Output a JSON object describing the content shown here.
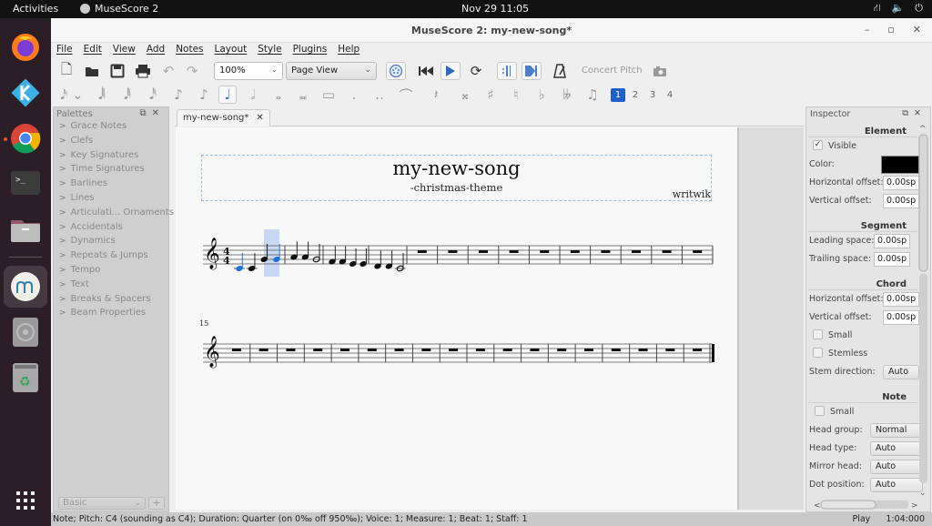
{
  "topbar": {
    "activities": "Activities",
    "app_name": "MuseScore 2",
    "clock": "Nov 29  11:05",
    "tray_icons": [
      "network-icon",
      "volume-icon",
      "power-icon"
    ]
  },
  "dock": {
    "items": [
      {
        "name": "firefox",
        "icon": "firefox-icon",
        "running": false
      },
      {
        "name": "kodi",
        "icon": "kodi-icon",
        "running": false
      },
      {
        "name": "chrome",
        "icon": "chrome-icon",
        "running": true
      },
      {
        "name": "terminal",
        "icon": "terminal-icon",
        "running": false
      },
      {
        "name": "files",
        "icon": "folder-icon",
        "running": false
      },
      {
        "name": "musescore",
        "icon": "musescore-icon",
        "running": true,
        "active": true
      },
      {
        "name": "disc",
        "icon": "disc-icon",
        "running": false
      },
      {
        "name": "trash",
        "icon": "trash-icon",
        "running": false
      }
    ],
    "show_apps": "apps-grid-icon"
  },
  "window": {
    "title": "MuseScore 2: my-new-song*",
    "controls": {
      "minimize": "–",
      "maximize": "▫",
      "close": "✕"
    }
  },
  "menu": [
    "File",
    "Edit",
    "View",
    "Add",
    "Notes",
    "Layout",
    "Style",
    "Plugins",
    "Help"
  ],
  "toolbar": {
    "zoom_value": "100%",
    "view_mode": "Page View",
    "concert_pitch": "Concert Pitch",
    "note_durations": [
      "64th",
      "32nd",
      "16th",
      "8th",
      "quarter",
      "half",
      "whole",
      "breve",
      "longa"
    ],
    "selected_duration": "quarter",
    "voices": [
      "1",
      "2",
      "3",
      "4"
    ],
    "active_voice": "1"
  },
  "palettes": {
    "title": "Palettes",
    "items": [
      "Grace Notes",
      "Clefs",
      "Key Signatures",
      "Time Signatures",
      "Barlines",
      "Lines",
      "Articulati... Ornaments",
      "Accidentals",
      "Dynamics",
      "Repeats & Jumps",
      "Tempo",
      "Text",
      "Breaks & Spacers",
      "Beam Properties"
    ],
    "workspace": "Basic",
    "add_label": "+"
  },
  "score": {
    "tab_label": "my-new-song*",
    "title": "my-new-song",
    "subtitle": "-christmas-theme",
    "composer": "writwik",
    "time_signature": "4/4",
    "clef": "treble",
    "system2_start_measure": "15",
    "system1": {
      "note_measures": [
        [
          {
            "pitch": "C4",
            "dur": "q",
            "selected": true
          },
          {
            "pitch": "C4",
            "dur": "q"
          },
          {
            "pitch": "G4",
            "dur": "q"
          },
          {
            "pitch": "G4",
            "dur": "q",
            "selected": true
          }
        ],
        [
          {
            "pitch": "A4",
            "dur": "q"
          },
          {
            "pitch": "A4",
            "dur": "q"
          },
          {
            "pitch": "G4",
            "dur": "h"
          }
        ],
        [
          {
            "pitch": "F4",
            "dur": "q"
          },
          {
            "pitch": "F4",
            "dur": "q"
          },
          {
            "pitch": "E4",
            "dur": "q"
          },
          {
            "pitch": "E4",
            "dur": "q"
          }
        ],
        [
          {
            "pitch": "D4",
            "dur": "q"
          },
          {
            "pitch": "D4",
            "dur": "q"
          },
          {
            "pitch": "C4",
            "dur": "h"
          }
        ]
      ],
      "rest_measures": 10
    },
    "system2": {
      "rest_measures": 18
    }
  },
  "inspector": {
    "title": "Inspector",
    "element": {
      "heading": "Element",
      "visible_label": "Visible",
      "visible": true,
      "color_label": "Color:",
      "color": "#000000",
      "h_offset_label": "Horizontal offset:",
      "h_offset": "0.00sp",
      "v_offset_label": "Vertical offset:",
      "v_offset": "0.00sp"
    },
    "segment": {
      "heading": "Segment",
      "leading_label": "Leading space:",
      "leading": "0.00sp",
      "trailing_label": "Trailing space:",
      "trailing": "0.00sp"
    },
    "chord": {
      "heading": "Chord",
      "h_offset_label": "Horizontal offset:",
      "h_offset": "0.00sp",
      "v_offset_label": "Vertical offset:",
      "v_offset": "0.00sp",
      "small_label": "Small",
      "small": false,
      "stemless_label": "Stemless",
      "stemless": false,
      "stem_dir_label": "Stem direction:",
      "stem_dir": "Auto"
    },
    "note": {
      "heading": "Note",
      "small_label": "Small",
      "small": false,
      "head_group_label": "Head group:",
      "head_group": "Normal",
      "head_type_label": "Head type:",
      "head_type": "Auto",
      "mirror_label": "Mirror head:",
      "mirror": "Auto",
      "dot_label": "Dot position:",
      "dot": "Auto"
    }
  },
  "status": {
    "text": "Note; Pitch: C4 (sounding as C4); Duration: Quarter (on 0‰ off 950‰); Voice: 1; Measure: 1; Beat: 1; Staff: 1",
    "mode": "Play",
    "position": "1:04:000"
  },
  "colors": {
    "accent": "#1f5fc9",
    "selection": "#c8d8f0",
    "selected_note": "#1f6fe0"
  }
}
